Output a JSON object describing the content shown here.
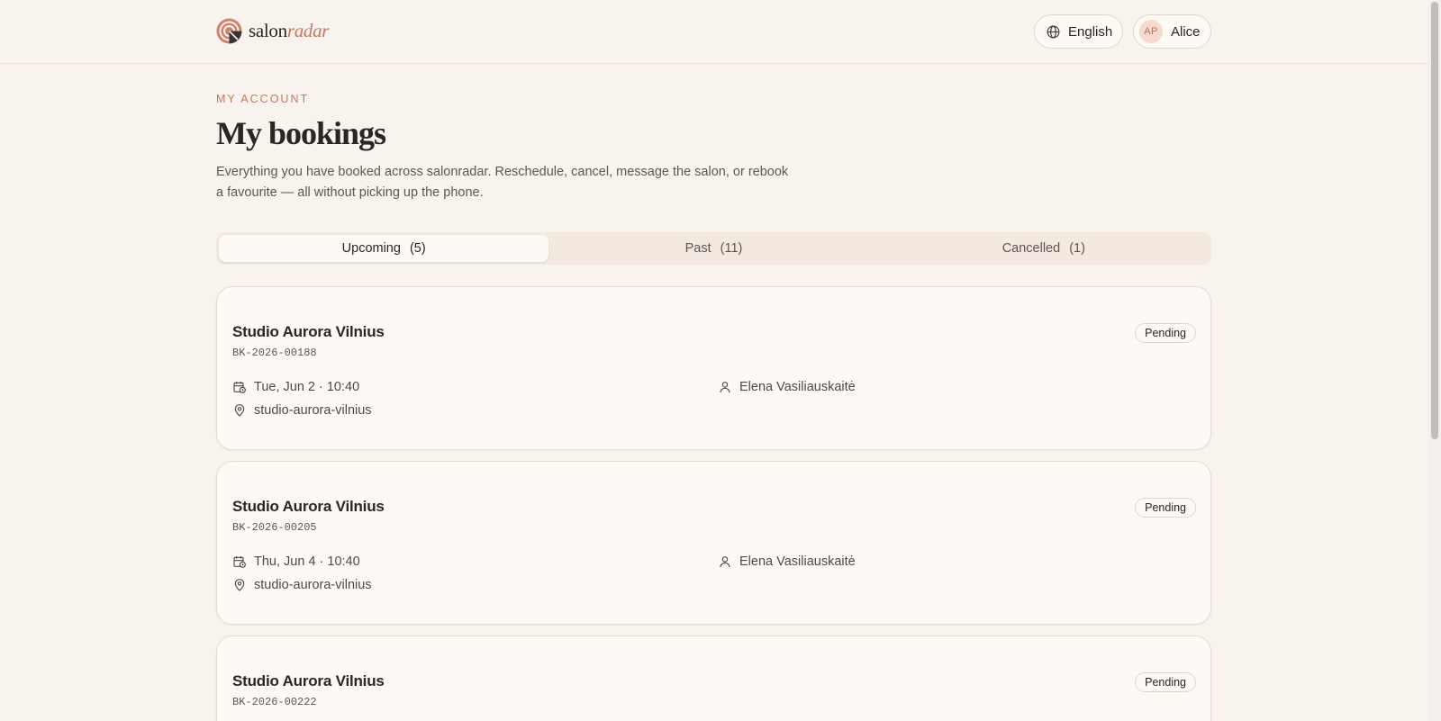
{
  "brand": {
    "name_main": "salon",
    "name_accent": "radar"
  },
  "header": {
    "language_label": "English",
    "user_initials": "AP",
    "user_name": "Alice"
  },
  "page": {
    "eyebrow": "MY ACCOUNT",
    "title": "My bookings",
    "description": "Everything you have booked across salonradar. Reschedule, cancel, message the salon, or rebook a favourite — all without picking up the phone."
  },
  "tabs": [
    {
      "label": "Upcoming",
      "count": "(5)",
      "active": true
    },
    {
      "label": "Past",
      "count": "(11)",
      "active": false
    },
    {
      "label": "Cancelled",
      "count": "(1)",
      "active": false
    }
  ],
  "bookings": [
    {
      "salon": "Studio Aurora Vilnius",
      "code": "BK-2026-00188",
      "status": "Pending",
      "datetime": "Tue, Jun 2 · 10:40",
      "location": "studio-aurora-vilnius",
      "staff": "Elena Vasiliauskaitė"
    },
    {
      "salon": "Studio Aurora Vilnius",
      "code": "BK-2026-00205",
      "status": "Pending",
      "datetime": "Thu, Jun 4 · 10:40",
      "location": "studio-aurora-vilnius",
      "staff": "Elena Vasiliauskaitė"
    },
    {
      "salon": "Studio Aurora Vilnius",
      "code": "BK-2026-00222",
      "status": "Pending",
      "datetime": "",
      "location": "",
      "staff": ""
    }
  ],
  "colors": {
    "accent": "#c9775f",
    "background": "#f9f3ee",
    "card": "#fdfaf6",
    "text": "#2a2624"
  }
}
